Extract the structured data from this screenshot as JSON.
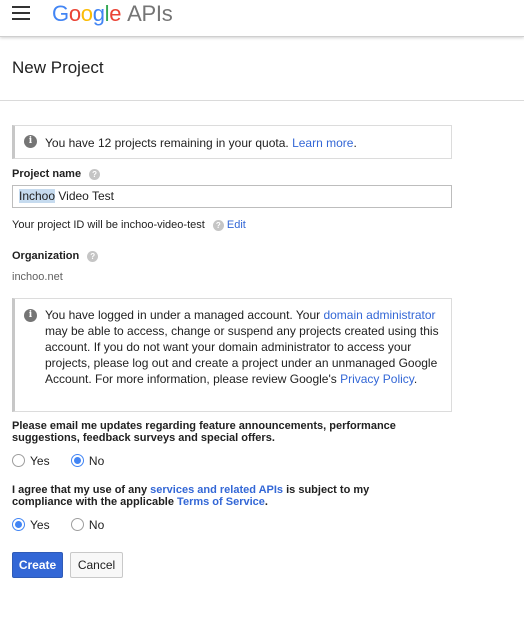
{
  "header": {
    "menu_icon": "hamburger-icon",
    "logo_letters": [
      {
        "char": "G",
        "color": "#4285f4"
      },
      {
        "char": "o",
        "color": "#ea4335"
      },
      {
        "char": "o",
        "color": "#fbbc05"
      },
      {
        "char": "g",
        "color": "#4285f4"
      },
      {
        "char": "l",
        "color": "#34a853"
      },
      {
        "char": "e",
        "color": "#ea4335"
      }
    ],
    "logo_suffix": "APIs"
  },
  "page": {
    "title": "New Project"
  },
  "quota_notice": {
    "icon": "info-icon",
    "text": "You have 12 projects remaining in your quota.",
    "link": "Learn more",
    "suffix": "."
  },
  "project_name": {
    "label": "Project name",
    "value_selected": "Inchoo",
    "value_rest": " Video Test"
  },
  "project_id": {
    "text": "Your project ID will be inchoo-video-test",
    "edit_link": "Edit"
  },
  "organization": {
    "label": "Organization",
    "value": "inchoo.net"
  },
  "managed_notice": {
    "icon": "info-icon",
    "text_1": "You have logged in under a managed account. Your ",
    "link_1": "domain administrator",
    "text_2": " may be able to access, change or suspend any projects created using this account. If you do not want your domain administrator to access your projects, please log out and create a project under an unmanaged Google Account. For more information, please review Google's ",
    "link_2": "Privacy Policy",
    "text_3": "."
  },
  "email_updates": {
    "question": "Please email me updates regarding feature announcements, performance suggestions, feedback surveys and special offers.",
    "options": [
      "Yes",
      "No"
    ],
    "selected": "No"
  },
  "terms": {
    "text_1": "I agree that my use of any ",
    "link_1": "services and related APIs",
    "text_2": " is subject to my compliance with the applicable ",
    "link_2": "Terms of Service",
    "text_3": ".",
    "options": [
      "Yes",
      "No"
    ],
    "selected": "Yes"
  },
  "buttons": {
    "create": "Create",
    "cancel": "Cancel"
  },
  "colors": {
    "accent": "#3367d6",
    "radio_checked": "#4285f4"
  }
}
